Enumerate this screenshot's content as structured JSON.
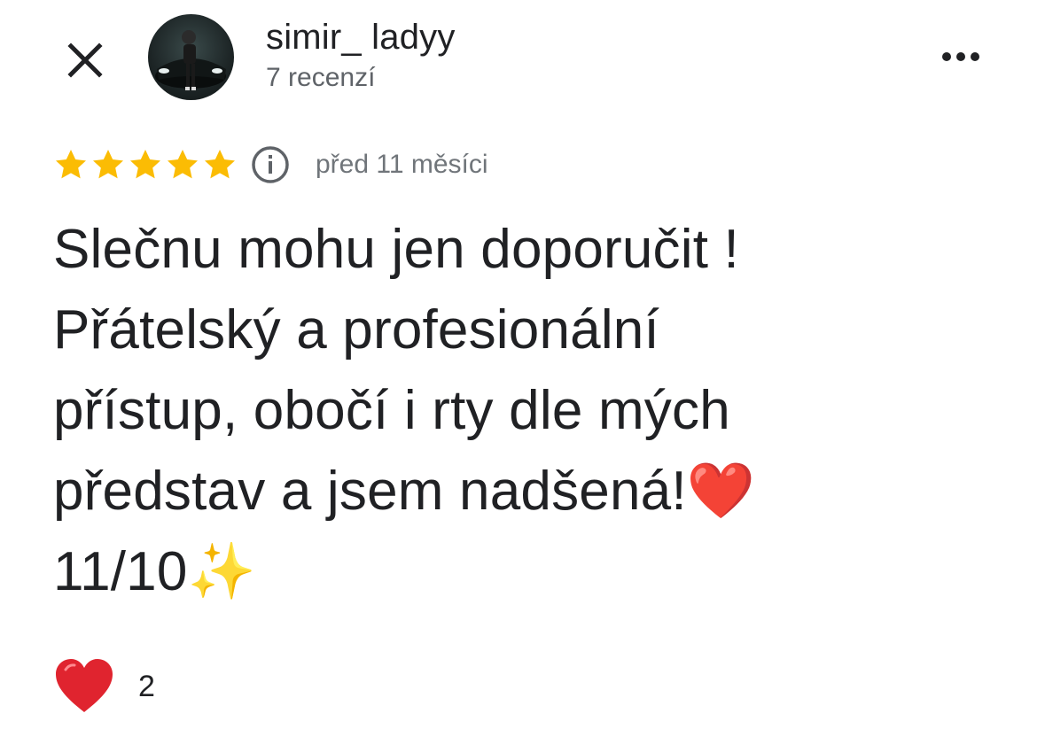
{
  "header": {
    "author_name": "simir_ ladyy",
    "review_count": "7 recenzí"
  },
  "rating": {
    "stars": 5,
    "max_stars": 5,
    "star_color": "#fbbc04",
    "time_ago": "před 11 měsíci"
  },
  "review": {
    "text": "Slečnu mohu jen doporučit !\nPřátelský a profesionální\npřístup, obočí i rty dle mých\npředstav a jsem nadšená!❤️\n11/10✨"
  },
  "reactions": {
    "icon": "heart-icon",
    "count": "2"
  },
  "icons": {
    "close": "close-icon",
    "more": "more-options-icon",
    "info": "info-icon"
  }
}
